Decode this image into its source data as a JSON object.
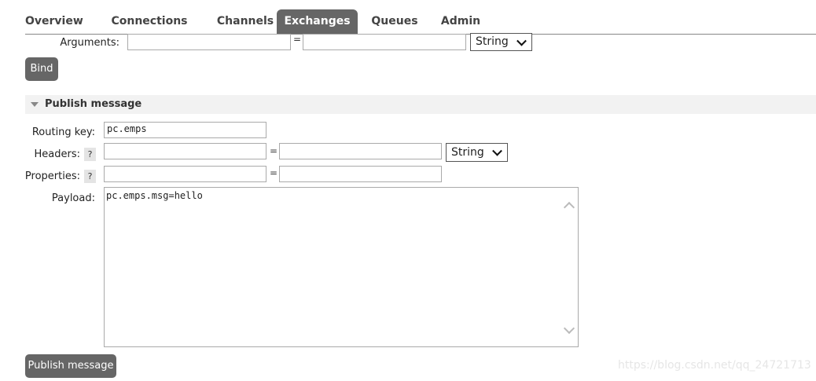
{
  "tabs": [
    {
      "label": "Overview"
    },
    {
      "label": "Connections"
    },
    {
      "label": "Channels"
    },
    {
      "label": "Exchanges",
      "active": true
    },
    {
      "label": "Queues"
    },
    {
      "label": "Admin"
    }
  ],
  "bind_section": {
    "arguments_label": "Arguments:",
    "equals": "=",
    "type_select": "String",
    "bind_button": "Bind"
  },
  "publish": {
    "title": "Publish message",
    "routing_key_label": "Routing key:",
    "routing_key_value": "pc.emps",
    "headers_label": "Headers:",
    "headers_help": "?",
    "headers_equals": "=",
    "headers_type": "String",
    "properties_label": "Properties:",
    "properties_help": "?",
    "properties_equals": "=",
    "payload_label": "Payload:",
    "payload_value": "pc.emps.msg=hello",
    "publish_button": "Publish message"
  },
  "watermark": "https://blog.csdn.net/qq_24721713"
}
